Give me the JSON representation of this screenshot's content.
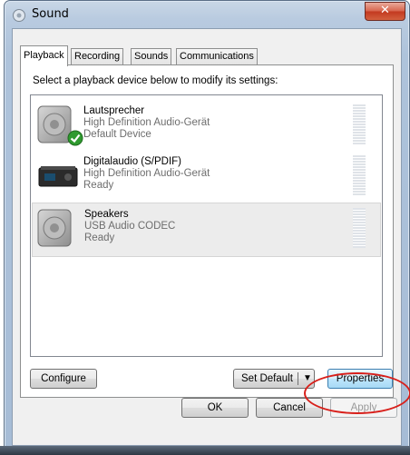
{
  "window": {
    "title": "Sound",
    "close_glyph": "✕"
  },
  "tabs": [
    {
      "label": "Playback",
      "active": true
    },
    {
      "label": "Recording",
      "active": false
    },
    {
      "label": "Sounds",
      "active": false
    },
    {
      "label": "Communications",
      "active": false
    }
  ],
  "instruction": "Select a playback device below to modify its settings:",
  "devices": [
    {
      "name": "Lautsprecher",
      "driver": "High Definition Audio-Gerät",
      "status": "Default Device",
      "icon": "speaker-icon",
      "badge": "default-check-icon"
    },
    {
      "name": "Digitalaudio (S/PDIF)",
      "driver": "High Definition Audio-Gerät",
      "status": "Ready",
      "icon": "digital-receiver-icon"
    },
    {
      "name": "Speakers",
      "driver": "USB Audio CODEC",
      "status": "Ready",
      "icon": "speaker-icon",
      "selected": true
    }
  ],
  "buttons": {
    "configure": "Configure",
    "set_default": "Set Default",
    "properties": "Properties",
    "ok": "OK",
    "cancel": "Cancel",
    "apply": "Apply"
  },
  "colors": {
    "highlight_ring": "#d8201b",
    "close_button": "#c2391f"
  }
}
